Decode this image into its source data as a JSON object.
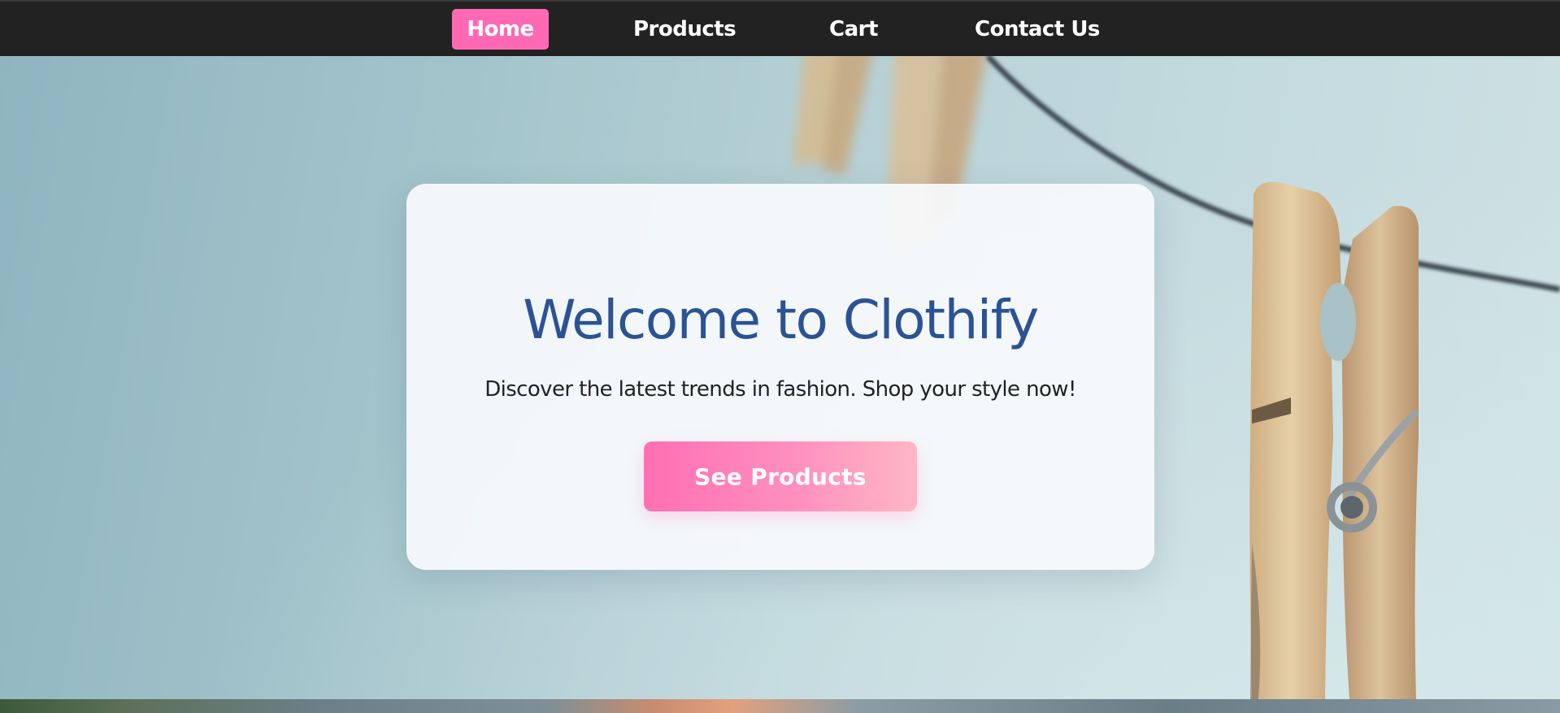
{
  "nav": {
    "items": [
      {
        "label": "Home",
        "active": true
      },
      {
        "label": "Products",
        "active": false
      },
      {
        "label": "Cart",
        "active": false
      },
      {
        "label": "Contact Us",
        "active": false
      }
    ]
  },
  "hero": {
    "title": "Welcome to Clothify",
    "subtitle": "Discover the latest trends in fashion. Shop your style now!",
    "cta_label": "See Products"
  },
  "colors": {
    "nav_background": "#222222",
    "nav_active": "#ff69b4",
    "title": "#2b5394",
    "cta_gradient_start": "#ff6fb3",
    "cta_gradient_end": "#ffb7c4",
    "card_background": "#f8fafc"
  }
}
